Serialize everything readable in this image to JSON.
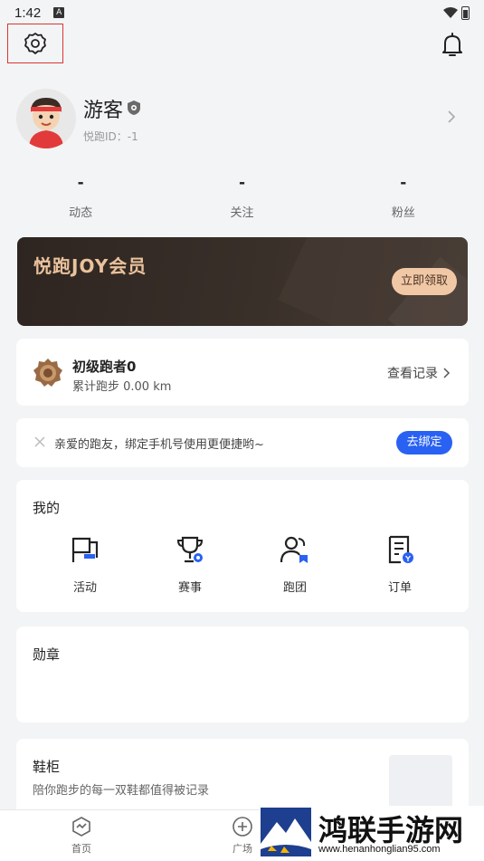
{
  "status_bar": {
    "time": "1:42",
    "notif_icon": "A"
  },
  "profile": {
    "name": "游客",
    "id_text": "悦跑ID：-1"
  },
  "stats": [
    {
      "value": "-",
      "label": "动态"
    },
    {
      "value": "-",
      "label": "关注"
    },
    {
      "value": "-",
      "label": "粉丝"
    }
  ],
  "vip": {
    "title": "悦跑JOY会员",
    "claim_label": "立即领取"
  },
  "level": {
    "name": "初级跑者0",
    "distance": "累计跑步 0.00 km",
    "link_label": "查看记录"
  },
  "bind": {
    "text": "亲爱的跑友，绑定手机号使用更便捷哟~",
    "button_label": "去绑定"
  },
  "mine": {
    "title": "我的",
    "items": [
      {
        "label": "活动",
        "icon": "flag-icon"
      },
      {
        "label": "赛事",
        "icon": "trophy-icon"
      },
      {
        "label": "跑团",
        "icon": "group-icon"
      },
      {
        "label": "订单",
        "icon": "order-icon"
      }
    ]
  },
  "medals": {
    "title": "勋章"
  },
  "shoes": {
    "title": "鞋柜",
    "subtitle": "陪你跑步的每一双鞋都值得被记录"
  },
  "bottom_nav": [
    {
      "label": "首页",
      "icon": "home-icon"
    },
    {
      "label": "广场",
      "icon": "plus-circle-icon"
    }
  ],
  "watermark": {
    "title": "鸿联手游网",
    "url": "www.henanhonglian95.com"
  },
  "colors": {
    "accent_blue": "#2962f2",
    "vip_gold": "#e9c29c",
    "vip_bg": "#2e2521",
    "highlight_red": "#dd3333"
  }
}
